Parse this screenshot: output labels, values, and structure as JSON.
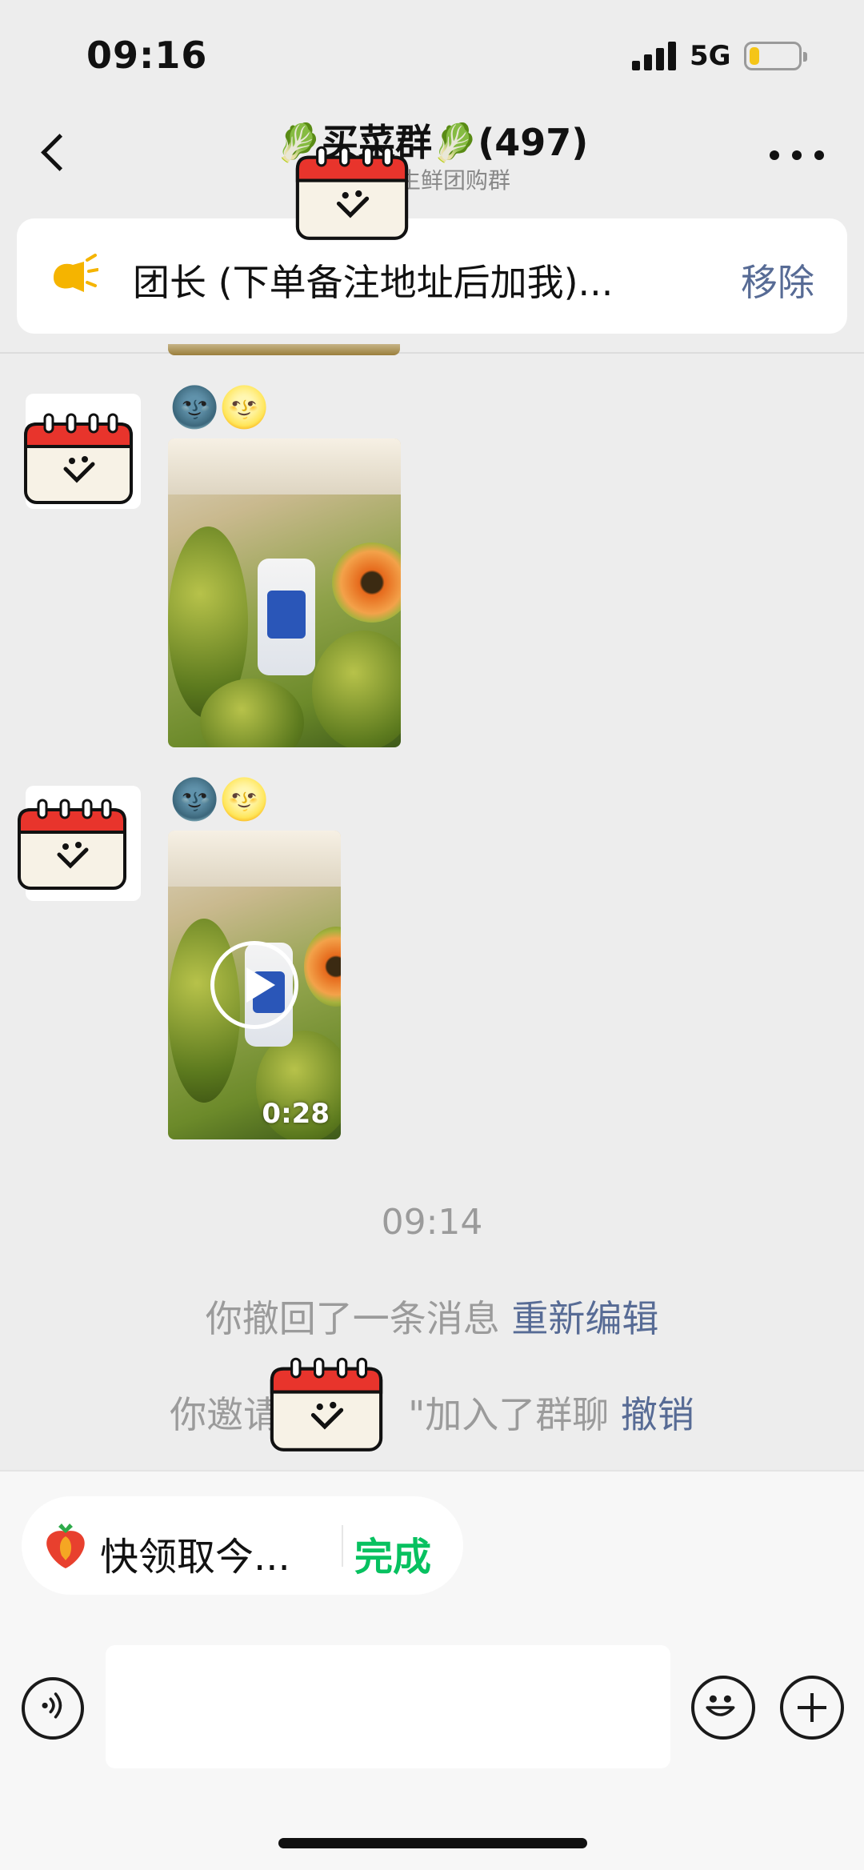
{
  "status_bar": {
    "time": "09:16",
    "network": "5G",
    "battery_level": 0.2,
    "battery_color": "#f5c518"
  },
  "header": {
    "title": "🥬买菜群🥬(497)",
    "subtitle": "水果生鲜团购群",
    "back_icon": "chevron-left-icon",
    "more_icon": "more-dots-icon"
  },
  "pinned_notice": {
    "icon": "megaphone-icon",
    "text": "团长 (下单备注地址后加我)...",
    "action": "移除"
  },
  "messages": [
    {
      "sender_emoji": "🌚🌝",
      "type": "image",
      "avatar_icon": "calendar-smile-icon"
    },
    {
      "sender_emoji": "🌚🌝",
      "type": "video",
      "duration": "0:28",
      "avatar_icon": "calendar-smile-icon"
    }
  ],
  "system": {
    "timestamp": "09:14",
    "recall_text": "你撤回了一条消息",
    "recall_link": "重新编辑",
    "invite_prefix": "你邀请",
    "invite_suffix": "\"加入了群聊",
    "invite_link": "撤销"
  },
  "task_chip": {
    "icon": "strawberry-icon",
    "text": "快领取今...",
    "done": "完成"
  },
  "input_bar": {
    "voice_icon": "voice-icon",
    "emoji_icon": "smiley-icon",
    "plus_icon": "plus-icon",
    "value": ""
  },
  "colors": {
    "background": "#ededed",
    "link": "#576b95",
    "done_green": "#07c160"
  }
}
